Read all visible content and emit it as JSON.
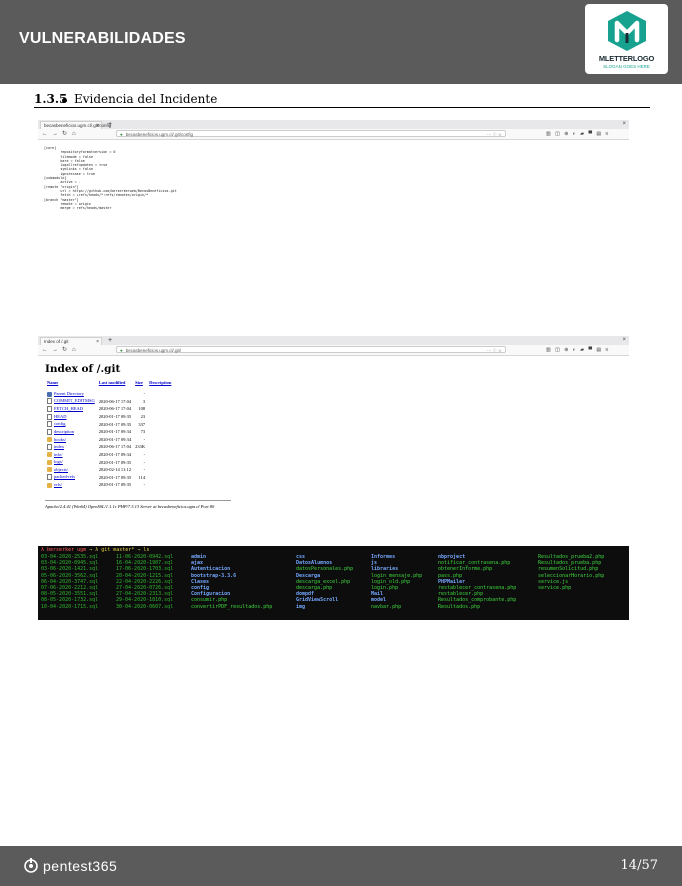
{
  "header": {
    "title": "VULNERABILIDADES",
    "logo_brand": "MLETTERLOGO",
    "logo_slogan": "SLOGAN GOES HERE"
  },
  "section": {
    "number": "1.3.5",
    "title": "Evidencia del Incidente"
  },
  "screenshot1": {
    "tab": "becasbeneficios.ugm.cl/.git/config",
    "url": "becasbeneficios.ugm.cl/.git/config",
    "lines": [
      "[core]",
      "        repositoryformatversion = 0",
      "        filemode = false",
      "        bare = false",
      "        logallrefupdates = true",
      "        symlinks = false",
      "        ignorecase = true",
      "[submodule]",
      "        active = .",
      "[remote \"origin\"]",
      "        url = https://github.com/berserkerweb/BecasBeneficios.git",
      "        fetch = +refs/heads/*:refs/remotes/origin/*",
      "[branch \"master\"]",
      "        remote = origin",
      "        merge = refs/heads/master"
    ]
  },
  "screenshot2": {
    "tab": "Index of /.git",
    "url": "becasbeneficios.ugm.cl/.git/",
    "heading": "Index of /.git",
    "columns": [
      "Name",
      "Last modified",
      "Size",
      "Description"
    ],
    "rows": [
      {
        "name": "Parent Directory",
        "date": "",
        "size": "-",
        "icon": "back"
      },
      {
        "name": "COMMIT_EDITMSG",
        "date": "2020-06-17 17:04",
        "size": "3",
        "icon": "file"
      },
      {
        "name": "FETCH_HEAD",
        "date": "2020-06-17 17:04",
        "size": "108",
        "icon": "file"
      },
      {
        "name": "HEAD",
        "date": "2020-01-17 09:35",
        "size": "23",
        "icon": "file"
      },
      {
        "name": "config",
        "date": "2020-01-17 09:35",
        "size": "337",
        "icon": "file"
      },
      {
        "name": "description",
        "date": "2020-01-17 09:34",
        "size": "73",
        "icon": "file"
      },
      {
        "name": "hooks/",
        "date": "2020-01-17 09:34",
        "size": "-",
        "icon": "folder"
      },
      {
        "name": "index",
        "date": "2020-06-17 17:04",
        "size": "233K",
        "icon": "file"
      },
      {
        "name": "info/",
        "date": "2020-01-17 09:34",
        "size": "-",
        "icon": "folder"
      },
      {
        "name": "logs/",
        "date": "2020-01-17 09:35",
        "size": "-",
        "icon": "folder"
      },
      {
        "name": "objects/",
        "date": "2020-02-14 11:12",
        "size": "-",
        "icon": "folder"
      },
      {
        "name": "packed-refs",
        "date": "2020-01-17 09:35",
        "size": "114",
        "icon": "file"
      },
      {
        "name": "refs/",
        "date": "2020-01-17 09:35",
        "size": "-",
        "icon": "folder"
      }
    ],
    "footer": "Apache/2.4.41 (Win64) OpenSSL/1.1.1c PHP/7.3.13 Server at becasbeneficios.ugm.cl Port 80"
  },
  "terminal": {
    "prompt_user": "λ berserker ugm",
    "prompt_rest": "→ λ git master* → ls",
    "col1": [
      "03-04-2020-2535.sql",
      "03-04-2020-0945.sql",
      "03-06-2020-1421.sql",
      "05-06-2020-3562.sql",
      "06-04-2020-3747.sql",
      "07-06-2020-2212.sql",
      "08-05-2020-3551.sql",
      "08-05-2020-1732.sql",
      "10-04-2020-1715.sql"
    ],
    "col2": [
      "11-06-2020-0942.sql",
      "16-04-2020-1907.sql",
      "17-06-2020-1703.sql",
      "20-04-2020-1215.sql",
      "22-04-2020-2226.sql",
      "27-04-2020-0726.sql",
      "27-04-2020-2313.sql",
      "29-04-2020-1810.sql",
      "30-04-2020-0607.sql"
    ],
    "col3": [
      {
        "t": "admin",
        "k": "b"
      },
      {
        "t": "ajax",
        "k": "b"
      },
      {
        "t": "Autenticacion",
        "k": "b"
      },
      {
        "t": "bootstrap-3.3.6",
        "k": "b"
      },
      {
        "t": "Clases",
        "k": "b"
      },
      {
        "t": "config",
        "k": "b"
      },
      {
        "t": "Configuracion",
        "k": "b"
      },
      {
        "t": "consumir.php",
        "k": "g"
      },
      {
        "t": "convertirPDF_resultados.php",
        "k": "g"
      }
    ],
    "col4": [
      {
        "t": "css",
        "k": "b"
      },
      {
        "t": "DatosAlumnos",
        "k": "b"
      },
      {
        "t": "datosPersonales.php",
        "k": "g"
      },
      {
        "t": "Descarga",
        "k": "b"
      },
      {
        "t": "descarga_excel.php",
        "k": "g"
      },
      {
        "t": "descarga.php",
        "k": "g"
      },
      {
        "t": "dompdf",
        "k": "b"
      },
      {
        "t": "GridViewScroll",
        "k": "b"
      },
      {
        "t": "img",
        "k": "b"
      }
    ],
    "col5": [
      {
        "t": "Informes",
        "k": "b"
      },
      {
        "t": "js",
        "k": "b"
      },
      {
        "t": "libraries",
        "k": "b"
      },
      {
        "t": "login_mensaje.php",
        "k": "g"
      },
      {
        "t": "login_old.php",
        "k": "g"
      },
      {
        "t": "login.php",
        "k": "g"
      },
      {
        "t": "Mail",
        "k": "b"
      },
      {
        "t": "model",
        "k": "b"
      },
      {
        "t": "navbar.php",
        "k": "g"
      }
    ],
    "col6": [
      {
        "t": "nbproject",
        "k": "b"
      },
      {
        "t": "notificar_contrasena.php",
        "k": "g"
      },
      {
        "t": "obtenerInforme.php",
        "k": "g"
      },
      {
        "t": "pass.php",
        "k": "g"
      },
      {
        "t": "PHPMailer",
        "k": "b"
      },
      {
        "t": "restablecer_contrasena.php",
        "k": "g"
      },
      {
        "t": "restablecer.php",
        "k": "g"
      },
      {
        "t": "Resultados_comprobante.php",
        "k": "g"
      },
      {
        "t": "Resultados.php",
        "k": "g"
      }
    ],
    "col7": [
      {
        "t": "Resultados_prueba2.php",
        "k": "g"
      },
      {
        "t": "Resultados_prueba.php",
        "k": "g"
      },
      {
        "t": "resumenSolicitud.php",
        "k": "g"
      },
      {
        "t": "seleccionarHorario.php",
        "k": "g"
      },
      {
        "t": "service.js",
        "k": "g"
      },
      {
        "t": "service.php",
        "k": "g"
      }
    ]
  },
  "footer": {
    "brand": "pentest365",
    "page": "14/57"
  },
  "colors": {
    "bar_bg": "#5b5b5b",
    "logo_teal": "#17a28f",
    "terminal_bg": "#0d0d0d",
    "terminal_green": "#3ed63e",
    "terminal_blue": "#74a8ff"
  }
}
